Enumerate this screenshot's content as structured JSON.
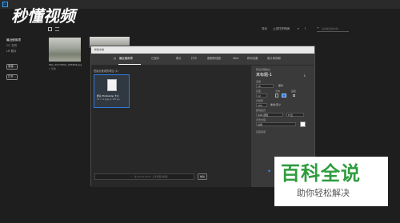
{
  "app": {
    "logo": "Ps",
    "watermark": "秒懂视频"
  },
  "sidebar": {
    "items": [
      "最近使用项",
      "CC 文件",
      "LR 照片"
    ],
    "new_button": "新建...",
    "open_button": "打开..."
  },
  "recent": {
    "file_name": "IMG_20170821_095846.jpg",
    "file_meta": "1 天前"
  },
  "toolbar": {
    "sort_label": "排序",
    "sort_value": "上次打开时间",
    "filter_placeholder": "过滤最近的文件"
  },
  "dialog": {
    "title": "新建文档",
    "tabs": [
      "最近使用项",
      "已保存",
      "照片",
      "打印",
      "图稿和插图",
      "Web",
      "移动设备",
      "胶片和视频"
    ],
    "preset_heading": "您最近使用的项目 (1)",
    "preset_card": {
      "name": "默认 Photoshop 大小",
      "meta": "16 x 12 厘米 @ 300 ppi"
    },
    "search_placeholder": "在 Adobe Stock 上查找更多模板",
    "search_go": "前往",
    "details": {
      "heading": "预设详细信息",
      "doc_name": "未标题-1",
      "width_label": "宽度",
      "width_value": "16",
      "width_unit": "厘米",
      "height_label": "高度",
      "height_value": "12",
      "orientation_label": "方向",
      "artboard_label": "画板",
      "resolution_label": "分辨率",
      "resolution_value": "300",
      "resolution_unit": "像素/英寸",
      "colormode_label": "颜色模式",
      "colormode_value": "RGB 颜色",
      "bitdepth_value": "8 位",
      "bg_label": "背景内容",
      "bg_value": "白色",
      "advanced_label": "高级选项"
    }
  },
  "badge": {
    "title": "百科全说",
    "subtitle": "助你轻松解决"
  }
}
